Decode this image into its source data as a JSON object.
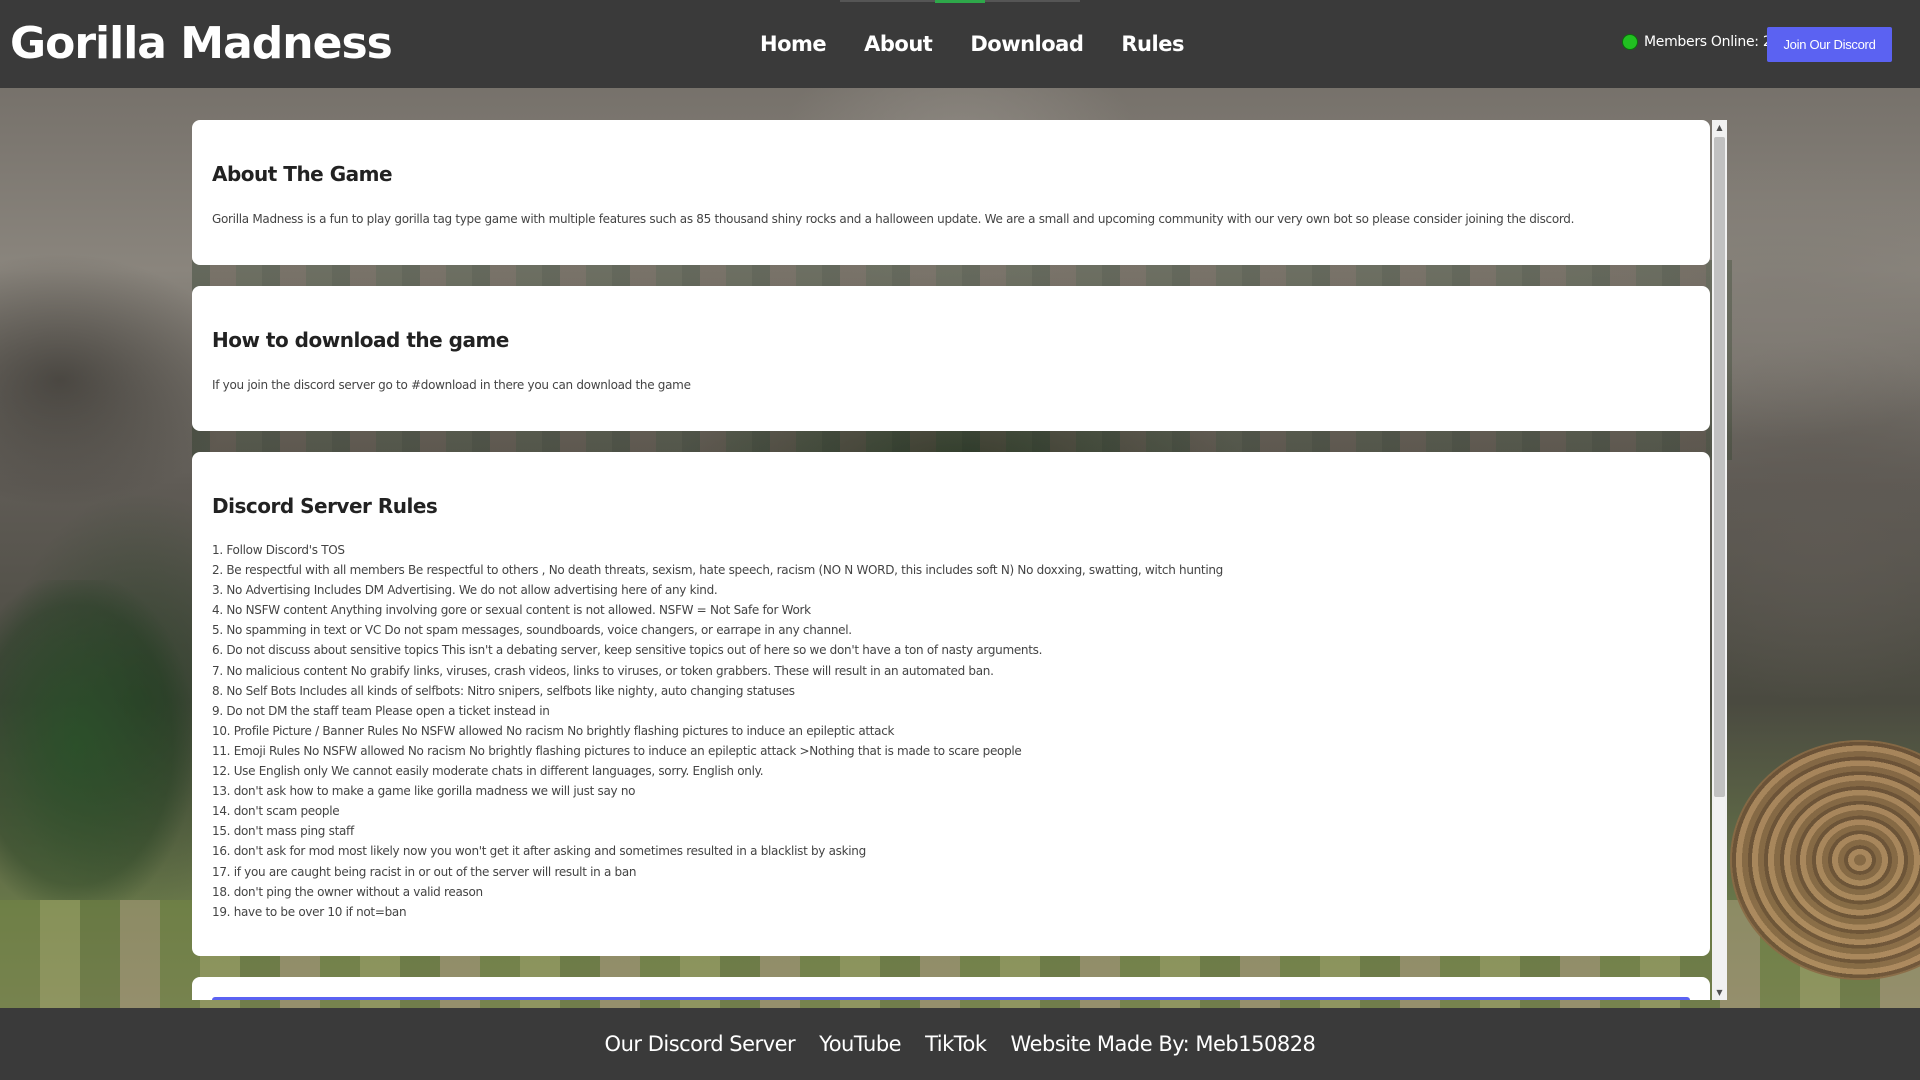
{
  "header": {
    "logo": "Gorilla Madness",
    "nav": [
      {
        "label": "Home"
      },
      {
        "label": "About"
      },
      {
        "label": "Download"
      },
      {
        "label": "Rules"
      }
    ],
    "members_online": "Members Online: 28",
    "discord_button": "Join Our Discord",
    "status_color": "#21c021",
    "accent_color": "#5b62f2"
  },
  "cards": {
    "about": {
      "title": "About The Game",
      "text": "Gorilla Madness is a fun to play gorilla tag type game with multiple features such as 85 thousand shiny rocks and a halloween update. We are a small and upcoming community with our very own bot so please consider joining the discord."
    },
    "download": {
      "title": "How to download the game",
      "text": "If you join the discord server go to #download in there you can download the game"
    },
    "rules": {
      "title": "Discord Server Rules",
      "items": [
        "1. Follow Discord's TOS",
        "2. Be respectful with all members Be respectful to others , No death threats, sexism, hate speech, racism (NO N WORD, this includes soft N) No doxxing, swatting, witch hunting",
        "3. No Advertising Includes DM Advertising. We do not allow advertising here of any kind.",
        "4. No NSFW content Anything involving gore or sexual content is not allowed. NSFW = Not Safe for Work",
        "5. No spamming in text or VC Do not spam messages, soundboards, voice changers, or earrape in any channel.",
        "6. Do not discuss about sensitive topics This isn't a debating server, keep sensitive topics out of here so we don't have a ton of nasty arguments.",
        "7. No malicious content No grabify links, viruses, crash videos, links to viruses, or token grabbers. These will result in an automated ban.",
        "8. No Self Bots Includes all kinds of selfbots: Nitro snipers, selfbots like nighty, auto changing statuses",
        "9. Do not DM the staff team Please open a ticket instead in",
        "10. Profile Picture / Banner Rules No NSFW allowed No racism No brightly flashing pictures to induce an epileptic attack",
        "11. Emoji Rules No NSFW allowed No racism No brightly flashing pictures to induce an epileptic attack >Nothing that is made to scare people",
        "12. Use English only We cannot easily moderate chats in different languages, sorry. English only.",
        "13. don't ask how to make a game like gorilla madness we will just say no",
        "14. don't scam people",
        "15. don't mass ping staff",
        "16. don't ask for mod most likely now you won't get it after asking and sometimes resulted in a blacklist by asking",
        "17. if you are caught being racist in or out of the server will result in a ban",
        "18. don't ping the owner without a valid reason",
        "19. have to be over 10 if not=ban"
      ]
    }
  },
  "scrollbar": {
    "up_arrow": "▲",
    "down_arrow": "▼"
  },
  "footer": {
    "links": [
      {
        "label": "Our Discord Server"
      },
      {
        "label": "YouTube"
      },
      {
        "label": "TikTok"
      }
    ],
    "credit": "Website Made By: Meb150828"
  }
}
